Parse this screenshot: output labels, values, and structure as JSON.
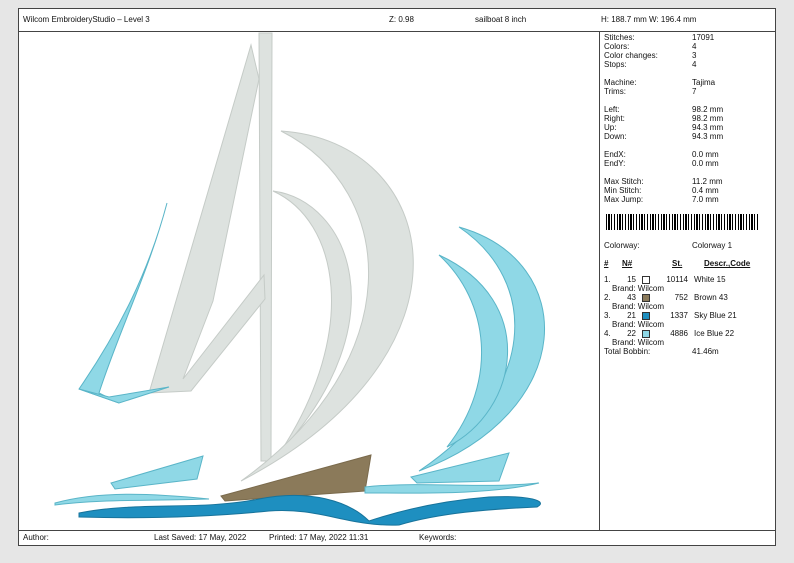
{
  "header": {
    "app_title": "Wilcom EmbroideryStudio – Level 3",
    "zoom": "Z: 0.98",
    "design_name": "sailboat 8 inch",
    "dimensions": "H: 188.7 mm   W: 196.4 mm"
  },
  "stats": [
    {
      "label": "Stitches:",
      "value": "17091"
    },
    {
      "label": "Colors:",
      "value": "4"
    },
    {
      "label": "Color changes:",
      "value": "3"
    },
    {
      "label": "Stops:",
      "value": "4"
    },
    {
      "label": "Machine:",
      "value": "Tajima"
    },
    {
      "label": "Trims:",
      "value": "7"
    },
    {
      "label": "Left:",
      "value": "98.2 mm"
    },
    {
      "label": "Right:",
      "value": "98.2 mm"
    },
    {
      "label": "Up:",
      "value": "94.3 mm"
    },
    {
      "label": "Down:",
      "value": "94.3 mm"
    },
    {
      "label": "EndX:",
      "value": "0.0 mm"
    },
    {
      "label": "EndY:",
      "value": "0.0 mm"
    },
    {
      "label": "Max Stitch:",
      "value": "11.2 mm"
    },
    {
      "label": "Min Stitch:",
      "value": "0.4 mm"
    },
    {
      "label": "Max Jump:",
      "value": "7.0 mm"
    }
  ],
  "colorway": {
    "label": "Colorway:",
    "value": "Colorway 1"
  },
  "table_headers": {
    "num": "#",
    "n": "N#",
    "st": "St.",
    "descr": "Descr.,Code"
  },
  "colors": [
    {
      "idx": "1.",
      "n": "15",
      "hex": "#ffffff",
      "st": "10114",
      "descr": "White 15",
      "brand": "Brand: Wilcom"
    },
    {
      "idx": "2.",
      "n": "43",
      "hex": "#8b7a5a",
      "st": "752",
      "descr": "Brown 43",
      "brand": "Brand: Wilcom"
    },
    {
      "idx": "3.",
      "n": "21",
      "hex": "#1e8fc0",
      "st": "1337",
      "descr": "Sky Blue 21",
      "brand": "Brand: Wilcom"
    },
    {
      "idx": "4.",
      "n": "22",
      "hex": "#8fd8e6",
      "st": "4886",
      "descr": "Ice Blue 22",
      "brand": "Brand: Wilcom"
    }
  ],
  "bobbin": {
    "label": "Total Bobbin:",
    "value": "41.46m"
  },
  "footer": {
    "author": "Author:",
    "last_saved": "Last Saved: 17 May, 2022",
    "printed": "Printed: 17 May, 2022 11:31",
    "keywords": "Keywords:"
  },
  "palette": {
    "white_sail": "#dde2df",
    "sail_stroke": "#c5cbc7",
    "brown": "#8b7a5a",
    "sky": "#1e8fc0",
    "ice": "#8fd8e6"
  }
}
